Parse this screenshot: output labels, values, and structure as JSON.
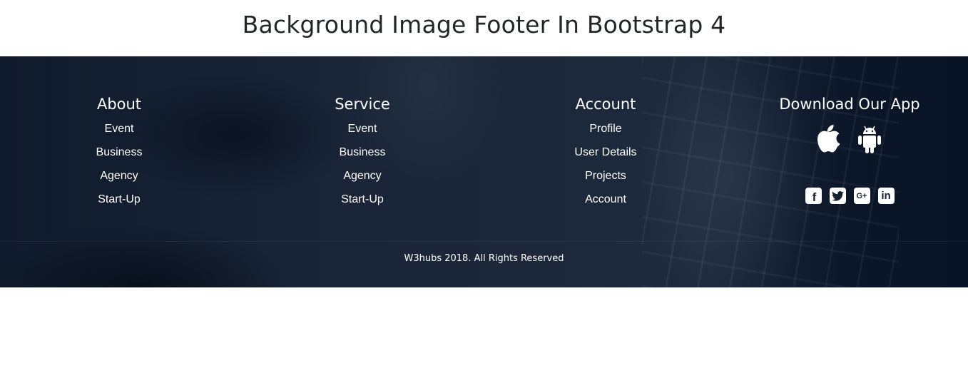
{
  "page": {
    "title": "Background Image Footer In Bootstrap 4"
  },
  "footer": {
    "columns": [
      {
        "heading": "About",
        "links": [
          "Event",
          "Business",
          "Agency",
          "Start-Up"
        ]
      },
      {
        "heading": "Service",
        "links": [
          "Event",
          "Business",
          "Agency",
          "Start-Up"
        ]
      },
      {
        "heading": "Account",
        "links": [
          "Profile",
          "User Details",
          "Projects",
          "Account"
        ]
      }
    ],
    "app": {
      "heading": "Download Our App",
      "icons": [
        "apple-icon",
        "android-icon"
      ]
    },
    "social": {
      "icons": [
        "facebook-icon",
        "twitter-icon",
        "google-plus-icon",
        "linkedin-icon"
      ],
      "facebook_glyph": "f",
      "google_glyph": "G+",
      "linkedin_glyph": "in"
    },
    "copyright": "W3hubs 2018. All Rights Reserved"
  },
  "colors": {
    "footer_bg": "#121e2f",
    "text": "#ffffff",
    "title_text": "#222529"
  }
}
